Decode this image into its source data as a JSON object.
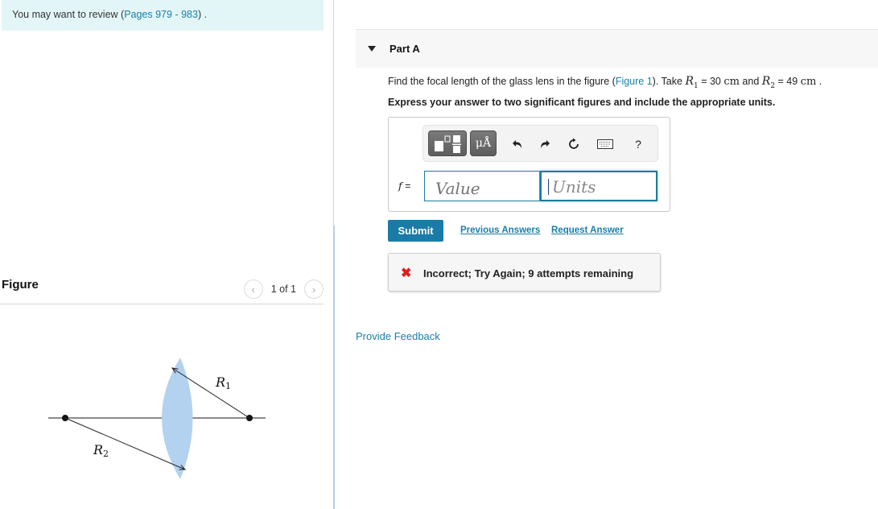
{
  "review": {
    "prefix": "You may want to review (",
    "link": "Pages 979 - 983",
    "suffix": ") ."
  },
  "figure": {
    "title": "Figure",
    "pager": {
      "label": "1 of 1",
      "prev_icon": "chevron-left-icon",
      "next_icon": "chevron-right-icon"
    },
    "labels": {
      "r1": "R",
      "r1_sub": "1",
      "r2": "R",
      "r2_sub": "2"
    },
    "colors": {
      "lens": "#b3d2f0",
      "line": "#333333"
    }
  },
  "part": {
    "title": "Part A",
    "question": {
      "text1": "Find the focal length of the glass lens in the figure (",
      "figure_link": "Figure 1",
      "text2": "). Take ",
      "r1_var": "R",
      "r1_sub": "1",
      "r1_value": " = 30 ",
      "r1_unit": "cm",
      "and": " and ",
      "r2_var": "R",
      "r2_sub": "2",
      "r2_value": " = 49 ",
      "r2_unit": "cm",
      "end": " ."
    },
    "instruction": "Express your answer to two significant figures and include the appropriate units.",
    "toolbar": {
      "templates_icon": "templates-icon",
      "units_label": "μÅ",
      "undo_icon": "undo-icon",
      "redo_icon": "redo-icon",
      "reset_icon": "reset-icon",
      "keyboard_icon": "keyboard-icon",
      "help_label": "?"
    },
    "equation": {
      "variable": "f",
      "equals": " =",
      "value_placeholder": "Value",
      "units_placeholder": "Units",
      "value": "",
      "units": ""
    },
    "actions": {
      "submit": "Submit",
      "previous_answers": "Previous Answers",
      "request_answer": "Request Answer"
    },
    "feedback": {
      "status": "incorrect",
      "message": "Incorrect; Try Again; 9 attempts remaining",
      "color": "#e01f1f"
    }
  },
  "provide_feedback": "Provide Feedback",
  "colors": {
    "accent": "#1a7ba6",
    "banner_bg": "#e3f6f7"
  }
}
